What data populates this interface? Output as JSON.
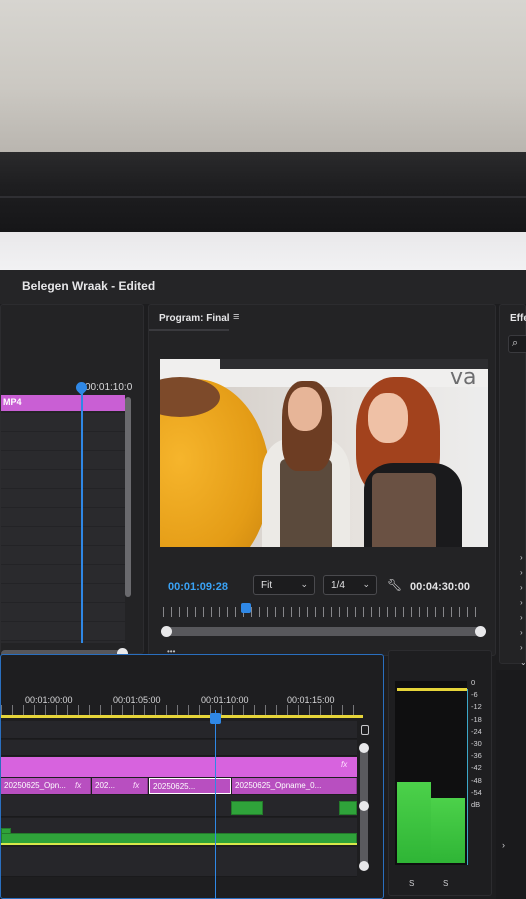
{
  "window": {
    "title": "Belegen Wraak - Edited"
  },
  "source": {
    "timecode": "00:01:10:0",
    "clip_name": "MP4",
    "tools": {
      "filter_icon": "filter-icon",
      "insert_icon": "insert-icon",
      "export_icon": "export-icon"
    }
  },
  "program": {
    "label": "Program: Final",
    "menu_icon": "≡",
    "current_timecode": "00:01:09:28",
    "fit_label": "Fit",
    "resolution_label": "1/4",
    "duration": "00:04:30:00",
    "video_overlay_text": "va"
  },
  "effects": {
    "tab": "Effe"
  },
  "timeline": {
    "ruler_labels": [
      "00:01:00:00",
      "00:01:05:00",
      "00:01:10:00",
      "00:01:15:00"
    ],
    "clips": [
      {
        "label": "20250625_Opn..."
      },
      {
        "label": "202..."
      },
      {
        "label": "20250625..."
      },
      {
        "label": "20250625_Opname_0..."
      }
    ],
    "fx_label": "fx"
  },
  "meters": {
    "scale": [
      "0",
      "-6",
      "-12",
      "-18",
      "-24",
      "-30",
      "-36",
      "-42",
      "-48",
      "-54",
      "dB"
    ],
    "channels": [
      "S",
      "S"
    ],
    "levels": [
      0.46,
      0.37
    ],
    "peak_color": "#e6d53a",
    "meter_color": "#3fc441"
  },
  "colors": {
    "accent": "#2f88e6",
    "timecode": "#3aa2f5",
    "video_clip": "#d763de",
    "audio_clip": "#2fa33a"
  }
}
